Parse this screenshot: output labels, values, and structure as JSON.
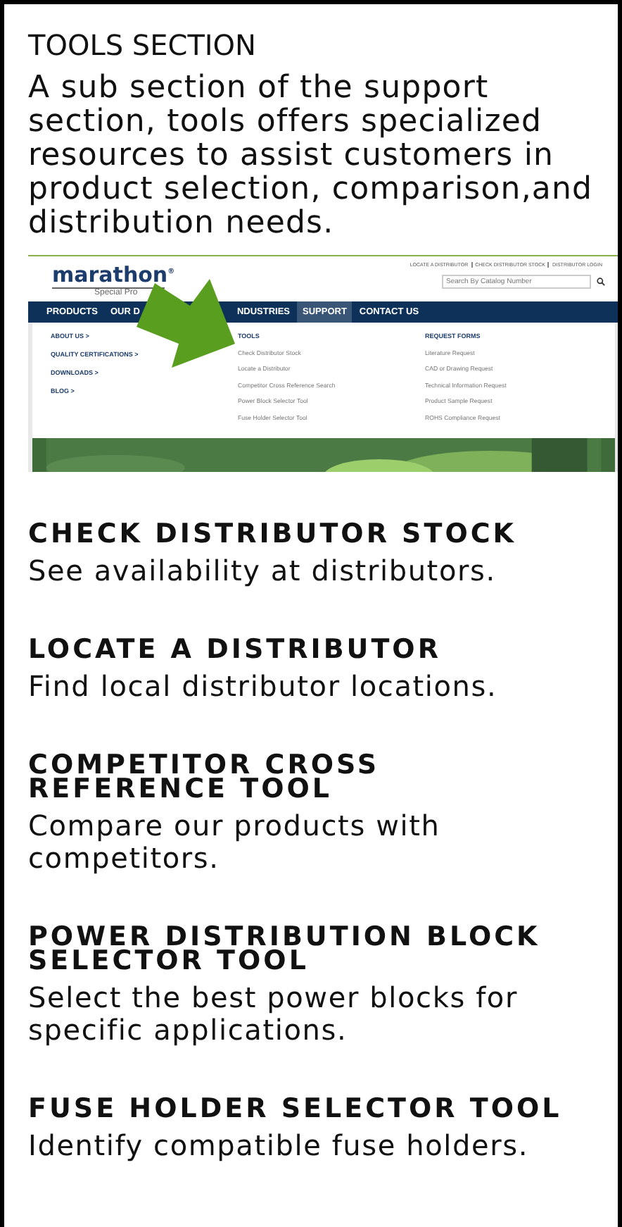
{
  "title": "TOOLS SECTION",
  "description": "A sub section of the support section, tools offers specialized resources to assist customers in product selection, comparison,and distribution needs.",
  "screenshot": {
    "top_links": [
      "LOCATE A DISTRIBUTOR",
      "CHECK DISTRIBUTOR STOCK",
      "DISTRIBUTOR LOGIN"
    ],
    "logo": "marathon",
    "logo_mark": "®",
    "logo_subtitle": "Special Pro",
    "search": {
      "placeholder": "Search By Catalog Number"
    },
    "nav": [
      {
        "label": "PRODUCTS",
        "selected": false
      },
      {
        "label": "OUR D",
        "selected": false
      },
      {
        "label": "NDUSTRIES",
        "selected": false
      },
      {
        "label": "SUPPORT",
        "selected": true
      },
      {
        "label": "CONTACT US",
        "selected": false
      }
    ],
    "menu_links": [
      "ABOUT US >",
      "QUALITY CERTIFICATIONS >",
      "DOWNLOADS >",
      "BLOG >"
    ],
    "tools": {
      "heading": "TOOLS",
      "items": [
        "Check Distributor Stock",
        "Locate a Distributor",
        "Competitor Cross Reference Search",
        "Power Block Selector Tool",
        "Fuse Holder Selector Tool"
      ]
    },
    "request_forms": {
      "heading": "REQUEST FORMS",
      "items": [
        "Literature Request",
        "CAD or Drawing Request",
        "Technical Information Request",
        "Product Sample Request",
        "ROHS Compliance Request"
      ]
    }
  },
  "tools": [
    {
      "heading_lines": [
        "CHECK DISTRIBUTOR STOCK"
      ],
      "description": "See availability at distributors."
    },
    {
      "heading_lines": [
        "LOCATE A DISTRIBUTOR"
      ],
      "description": "Find local distributor locations."
    },
    {
      "heading_lines": [
        "COMPETITOR CROSS",
        "REFERENCE TOOL"
      ],
      "description": "Compare our products with competitors."
    },
    {
      "heading_lines": [
        "POWER DISTRIBUTION BLOCK",
        "SELECTOR TOOL"
      ],
      "description": "Select the best power blocks for specific applications."
    },
    {
      "heading_lines": [
        "FUSE HOLDER SELECTOR TOOL"
      ],
      "description": "Identify compatible fuse holders."
    }
  ]
}
